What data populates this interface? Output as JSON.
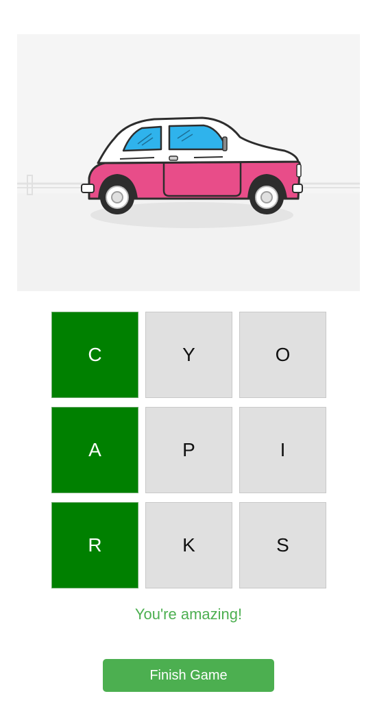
{
  "image": {
    "subject": "car-illustration",
    "colors": {
      "body": "#e84d89",
      "roof": "#ffffff",
      "window": "#2fb3ec",
      "outline": "#2d2d2d",
      "background": "#f5f5f5"
    }
  },
  "grid": {
    "tiles": [
      {
        "letter": "C",
        "selected": true
      },
      {
        "letter": "Y",
        "selected": false
      },
      {
        "letter": "O",
        "selected": false
      },
      {
        "letter": "A",
        "selected": true
      },
      {
        "letter": "P",
        "selected": false
      },
      {
        "letter": "I",
        "selected": false
      },
      {
        "letter": "R",
        "selected": true
      },
      {
        "letter": "K",
        "selected": false
      },
      {
        "letter": "S",
        "selected": false
      }
    ],
    "colors": {
      "selected": "#008000",
      "unselected": "#e0e0e0"
    }
  },
  "message": "You're amazing!",
  "finish_button": {
    "label": "Finish Game",
    "color": "#4caf50"
  }
}
